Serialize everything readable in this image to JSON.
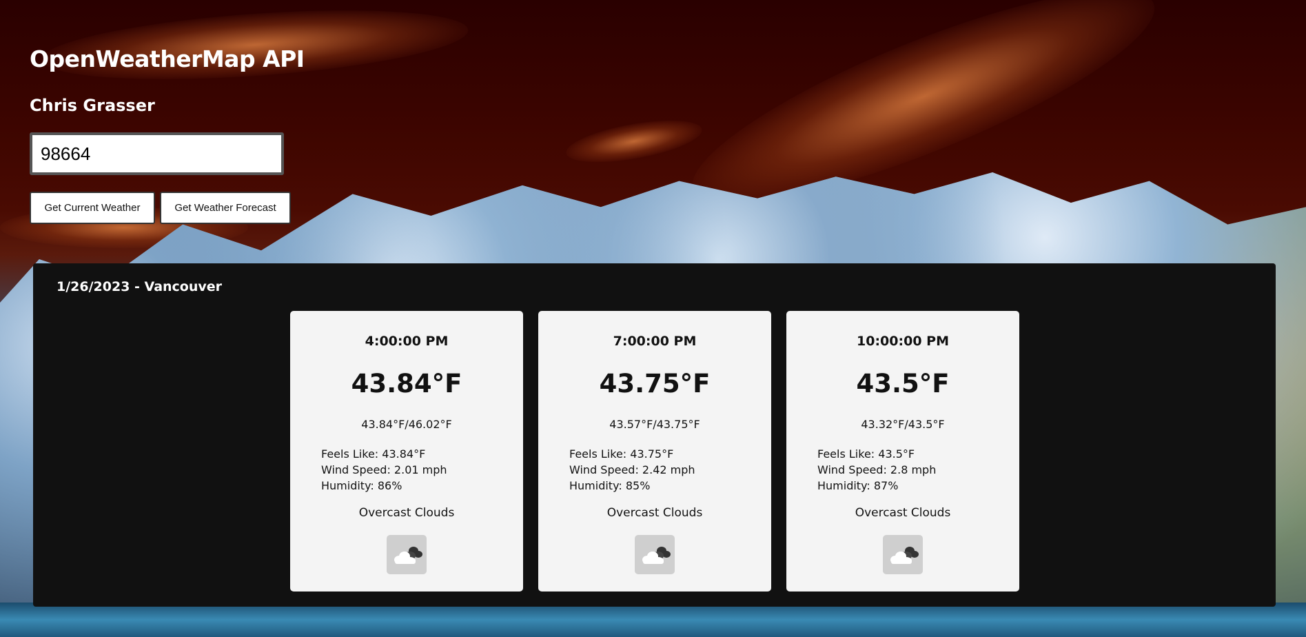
{
  "app": {
    "title": "OpenWeatherMap API",
    "author": "Chris Grasser"
  },
  "search": {
    "zip_value": "98664",
    "current_button_label": "Get Current Weather",
    "forecast_button_label": "Get Weather Forecast"
  },
  "forecast": {
    "heading": "1/26/2023 - Vancouver",
    "cards": [
      {
        "time": "4:00:00 PM",
        "temp": "43.84°F",
        "range": "43.84°F/46.02°F",
        "feels_like": "Feels Like: 43.84°F",
        "wind": "Wind Speed: 2.01 mph",
        "humidity": "Humidity: 86%",
        "description": "Overcast Clouds",
        "icon": "overcast-clouds-icon"
      },
      {
        "time": "7:00:00 PM",
        "temp": "43.75°F",
        "range": "43.57°F/43.75°F",
        "feels_like": "Feels Like: 43.75°F",
        "wind": "Wind Speed: 2.42 mph",
        "humidity": "Humidity: 85%",
        "description": "Overcast Clouds",
        "icon": "overcast-clouds-icon"
      },
      {
        "time": "10:00:00 PM",
        "temp": "43.5°F",
        "range": "43.32°F/43.5°F",
        "feels_like": "Feels Like: 43.5°F",
        "wind": "Wind Speed: 2.8 mph",
        "humidity": "Humidity: 87%",
        "description": "Overcast Clouds",
        "icon": "overcast-clouds-icon"
      }
    ]
  },
  "colors": {
    "panel_bg": "#111111",
    "card_bg": "#f4f4f4",
    "sky_dark": "#3d0500"
  }
}
